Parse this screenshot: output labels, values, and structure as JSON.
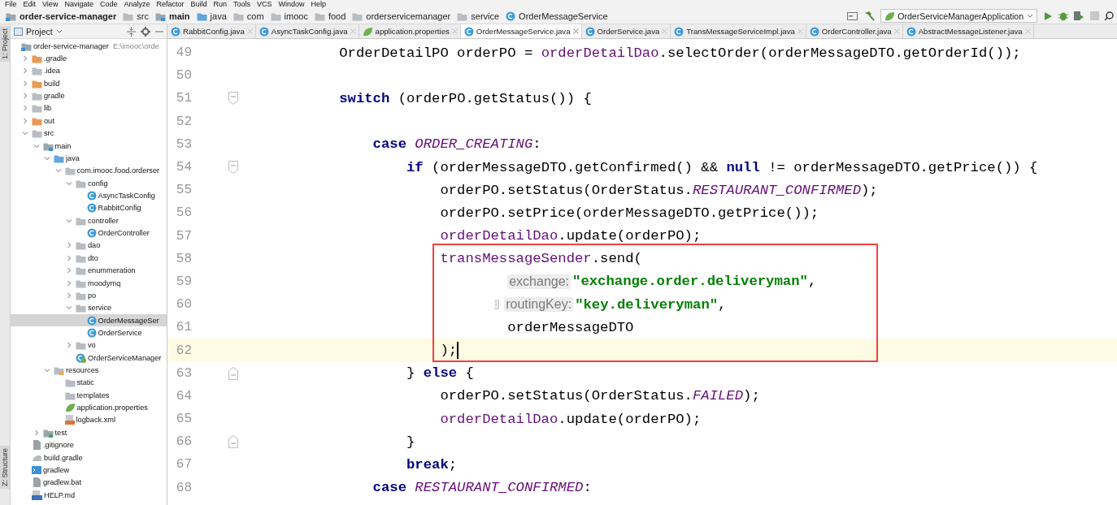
{
  "menu": [
    "File",
    "Edit",
    "View",
    "Navigate",
    "Code",
    "Analyze",
    "Refactor",
    "Build",
    "Run",
    "Tools",
    "VCS",
    "Window",
    "Help"
  ],
  "breadcrumbs": [
    {
      "label": "order-service-manager",
      "kind": "module",
      "bold": true
    },
    {
      "label": "src",
      "kind": "folder",
      "bold": false
    },
    {
      "label": "main",
      "kind": "module-folder",
      "bold": true
    },
    {
      "label": "java",
      "kind": "source-root",
      "bold": false
    },
    {
      "label": "com",
      "kind": "folder",
      "bold": false
    },
    {
      "label": "imooc",
      "kind": "folder",
      "bold": false
    },
    {
      "label": "food",
      "kind": "folder",
      "bold": false
    },
    {
      "label": "orderservicemanager",
      "kind": "folder",
      "bold": false
    },
    {
      "label": "service",
      "kind": "folder",
      "bold": false
    },
    {
      "label": "OrderMessageService",
      "kind": "class",
      "bold": false
    }
  ],
  "run_config": {
    "label": "OrderServiceManagerApplication"
  },
  "side_stripe": {
    "top": "1: Project",
    "bottom": "Z: Structure"
  },
  "project_panel": {
    "title": "Project",
    "tree": [
      {
        "label": "order-service-manager",
        "kind": "module",
        "note": "E:\\imooc\\orde",
        "selected": false,
        "children": [
          {
            "label": ".gradle",
            "kind": "excluded-folder",
            "expanded": false,
            "selected": false
          },
          {
            "label": ".idea",
            "kind": "folder",
            "expanded": false,
            "selected": false
          },
          {
            "label": "build",
            "kind": "excluded-folder",
            "expanded": false,
            "selected": false
          },
          {
            "label": "gradle",
            "kind": "folder",
            "expanded": false,
            "selected": false
          },
          {
            "label": "lib",
            "kind": "folder",
            "expanded": false,
            "selected": false
          },
          {
            "label": "out",
            "kind": "excluded-folder",
            "expanded": false,
            "selected": false
          },
          {
            "label": "src",
            "kind": "folder",
            "expanded": true,
            "selected": false,
            "children": [
              {
                "label": "main",
                "kind": "module-folder",
                "expanded": true,
                "selected": false,
                "children": [
                  {
                    "label": "java",
                    "kind": "source-root",
                    "expanded": true,
                    "selected": false,
                    "children": [
                      {
                        "label": "com.imooc.food.orderser",
                        "kind": "folder",
                        "expanded": true,
                        "selected": false,
                        "children": [
                          {
                            "label": "config",
                            "kind": "folder",
                            "expanded": true,
                            "selected": false,
                            "children": [
                              {
                                "label": "AsyncTaskConfig",
                                "kind": "class",
                                "selected": false
                              },
                              {
                                "label": "RabbitConfig",
                                "kind": "class",
                                "selected": false
                              }
                            ]
                          },
                          {
                            "label": "controller",
                            "kind": "folder",
                            "expanded": true,
                            "selected": false,
                            "children": [
                              {
                                "label": "OrderController",
                                "kind": "class",
                                "selected": false
                              }
                            ]
                          },
                          {
                            "label": "dao",
                            "kind": "folder",
                            "expanded": false,
                            "selected": false
                          },
                          {
                            "label": "dto",
                            "kind": "folder",
                            "expanded": false,
                            "selected": false
                          },
                          {
                            "label": "enummeration",
                            "kind": "folder",
                            "expanded": false,
                            "selected": false
                          },
                          {
                            "label": "moodymq",
                            "kind": "folder",
                            "expanded": false,
                            "selected": false
                          },
                          {
                            "label": "po",
                            "kind": "folder",
                            "expanded": false,
                            "selected": false
                          },
                          {
                            "label": "service",
                            "kind": "folder",
                            "expanded": true,
                            "selected": false,
                            "children": [
                              {
                                "label": "OrderMessageSer",
                                "kind": "class",
                                "selected": true
                              },
                              {
                                "label": "OrderService",
                                "kind": "class",
                                "selected": false
                              }
                            ]
                          },
                          {
                            "label": "vo",
                            "kind": "folder",
                            "expanded": false,
                            "selected": false
                          },
                          {
                            "label": "OrderServiceManager",
                            "kind": "app-class",
                            "selected": false
                          }
                        ]
                      }
                    ]
                  },
                  {
                    "label": "resources",
                    "kind": "resources-root",
                    "expanded": true,
                    "selected": false,
                    "children": [
                      {
                        "label": "static",
                        "kind": "folder",
                        "selected": false
                      },
                      {
                        "label": "templates",
                        "kind": "folder",
                        "selected": false
                      },
                      {
                        "label": "application.properties",
                        "kind": "properties",
                        "selected": false
                      },
                      {
                        "label": "logback.xml",
                        "kind": "xml",
                        "selected": false
                      }
                    ]
                  }
                ]
              },
              {
                "label": "test",
                "kind": "test-root",
                "expanded": false,
                "selected": false
              }
            ]
          },
          {
            "label": ".gitignore",
            "kind": "file",
            "selected": false
          },
          {
            "label": "build.gradle",
            "kind": "gradle-file",
            "selected": false
          },
          {
            "label": "gradlew",
            "kind": "script",
            "selected": false
          },
          {
            "label": "gradlew.bat",
            "kind": "file",
            "selected": false
          },
          {
            "label": "HELP.md",
            "kind": "markdown",
            "selected": false
          }
        ]
      }
    ]
  },
  "tabs": [
    {
      "label": "RabbitConfig.java",
      "kind": "class",
      "selected": false
    },
    {
      "label": "AsyncTaskConfig.java",
      "kind": "class",
      "selected": false
    },
    {
      "label": "application.properties",
      "kind": "properties",
      "selected": false
    },
    {
      "label": "OrderMessageService.java",
      "kind": "class",
      "selected": true
    },
    {
      "label": "OrderService.java",
      "kind": "class",
      "selected": false
    },
    {
      "label": "TransMessageServiceImpl.java",
      "kind": "class",
      "selected": false
    },
    {
      "label": "OrderController.java",
      "kind": "class",
      "selected": false
    },
    {
      "label": "AbstractMessageListener.java",
      "kind": "class",
      "selected": false
    }
  ],
  "editor": {
    "lines": [
      {
        "number": "49",
        "kind": "code",
        "current": false,
        "fold_start": false,
        "fold_end": false,
        "annotated": false,
        "tokens": [
          {
            "kind": "plain",
            "text": "OrderDetailPO orderPO = "
          },
          {
            "kind": "field",
            "text": "orderDetailDao"
          },
          {
            "kind": "plain",
            "text": ".selectOrder(orderMessageDTO.getOrderId());"
          }
        ]
      },
      {
        "number": "50",
        "kind": "code",
        "current": false,
        "fold_start": false,
        "fold_end": false,
        "annotated": false
      },
      {
        "number": "51",
        "kind": "code",
        "current": false,
        "fold_start": true,
        "fold_end": false,
        "annotated": false,
        "tokens": [
          {
            "kind": "keyword",
            "text": "switch"
          },
          {
            "kind": "plain",
            "text": " (orderPO.getStatus()) {"
          }
        ],
        "children": [
          {
            "number": "52",
            "kind": "code",
            "current": false,
            "fold_start": false,
            "fold_end": false,
            "annotated": false
          },
          {
            "number": "53",
            "kind": "code",
            "current": false,
            "fold_start": false,
            "fold_end": false,
            "annotated": false,
            "tokens": [
              {
                "kind": "keyword",
                "text": "case"
              },
              {
                "kind": "constant",
                "text": "ORDER_CREATING"
              },
              {
                "kind": "plain",
                "text": ":"
              }
            ],
            "children": [
              {
                "number": "54",
                "kind": "code",
                "current": false,
                "fold_start": true,
                "fold_end": false,
                "annotated": false,
                "tokens": [
                  {
                    "kind": "keyword",
                    "text": "if"
                  },
                  {
                    "kind": "plain",
                    "text": " (orderMessageDTO.getConfirmed() && "
                  },
                  {
                    "kind": "keyword",
                    "text": "null"
                  },
                  {
                    "kind": "plain",
                    "text": " != orderMessageDTO.getPrice()) {"
                  }
                ],
                "children": [
                  {
                    "number": "55",
                    "kind": "code",
                    "current": false,
                    "fold_start": false,
                    "fold_end": false,
                    "annotated": false,
                    "tokens": [
                      {
                        "kind": "plain",
                        "text": "orderPO.setStatus(OrderStatus."
                      },
                      {
                        "kind": "constant",
                        "text": "RESTAURANT_CONFIRMED"
                      },
                      {
                        "kind": "plain",
                        "text": ");"
                      }
                    ]
                  },
                  {
                    "number": "56",
                    "kind": "code",
                    "current": false,
                    "fold_start": false,
                    "fold_end": false,
                    "annotated": false,
                    "tokens": [
                      {
                        "kind": "plain",
                        "text": "orderPO.setPrice(orderMessageDTO.getPrice());"
                      }
                    ]
                  },
                  {
                    "number": "57",
                    "kind": "code",
                    "current": false,
                    "fold_start": false,
                    "fold_end": false,
                    "annotated": false,
                    "tokens": [
                      {
                        "kind": "field",
                        "text": "orderDetailDao"
                      },
                      {
                        "kind": "plain",
                        "text": ".update(orderPO);"
                      }
                    ]
                  },
                  {
                    "number": "58",
                    "kind": "code",
                    "current": false,
                    "fold_start": false,
                    "fold_end": false,
                    "annotated": true,
                    "tokens": [
                      {
                        "kind": "field",
                        "text": "transMessageSender"
                      },
                      {
                        "kind": "plain",
                        "text": ".send("
                      }
                    ],
                    "children": [
                      {
                        "number": "59",
                        "kind": "continuation",
                        "current": false,
                        "fold_start": false,
                        "fold_end": false,
                        "annotated": true,
                        "tokens": [
                          {
                            "kind": "hint",
                            "text": "exchange:"
                          },
                          {
                            "kind": "string",
                            "text": "\"exchange.order.deliveryman\""
                          },
                          {
                            "kind": "plain",
                            "text": ","
                          }
                        ]
                      },
                      {
                        "number": "60",
                        "kind": "continuation",
                        "current": false,
                        "fold_start": false,
                        "fold_end": false,
                        "annotated": true,
                        "tokens": [
                          {
                            "kind": "marker"
                          },
                          {
                            "kind": "hint",
                            "text": "routingKey:"
                          },
                          {
                            "kind": "string",
                            "text": "\"key.deliveryman\""
                          },
                          {
                            "kind": "plain",
                            "text": ","
                          }
                        ]
                      },
                      {
                        "number": "61",
                        "kind": "continuation",
                        "current": false,
                        "fold_start": false,
                        "fold_end": false,
                        "annotated": true,
                        "tokens": [
                          {
                            "kind": "plain",
                            "text": "orderMessageDTO"
                          }
                        ]
                      }
                    ]
                  },
                  {
                    "number": "62",
                    "kind": "code",
                    "current": true,
                    "fold_start": false,
                    "fold_end": false,
                    "annotated": true,
                    "tokens": [
                      {
                        "kind": "plain",
                        "text": ");"
                      }
                    ]
                  }
                ]
              },
              {
                "number": "63",
                "kind": "code",
                "current": false,
                "fold_start": false,
                "fold_end": true,
                "annotated": false,
                "tokens": [
                  {
                    "kind": "plain",
                    "text": "} "
                  },
                  {
                    "kind": "keyword",
                    "text": "else"
                  },
                  {
                    "kind": "plain",
                    "text": " {"
                  }
                ],
                "children": [
                  {
                    "number": "64",
                    "kind": "code",
                    "current": false,
                    "fold_start": false,
                    "fold_end": false,
                    "annotated": false,
                    "tokens": [
                      {
                        "kind": "plain",
                        "text": "orderPO.setStatus(OrderStatus."
                      },
                      {
                        "kind": "constant",
                        "text": "FAILED"
                      },
                      {
                        "kind": "plain",
                        "text": ");"
                      }
                    ]
                  },
                  {
                    "number": "65",
                    "kind": "code",
                    "current": false,
                    "fold_start": false,
                    "fold_end": false,
                    "annotated": false,
                    "tokens": [
                      {
                        "kind": "field",
                        "text": "orderDetailDao"
                      },
                      {
                        "kind": "plain",
                        "text": ".update(orderPO);"
                      }
                    ]
                  }
                ]
              },
              {
                "number": "66",
                "kind": "code",
                "current": false,
                "fold_start": false,
                "fold_end": true,
                "annotated": false,
                "tokens": [
                  {
                    "kind": "plain",
                    "text": "}"
                  }
                ]
              },
              {
                "number": "67",
                "kind": "code",
                "current": false,
                "fold_start": false,
                "fold_end": false,
                "annotated": false,
                "tokens": [
                  {
                    "kind": "keyword",
                    "text": "break"
                  },
                  {
                    "kind": "plain",
                    "text": ";"
                  }
                ]
              }
            ]
          },
          {
            "number": "68",
            "kind": "code",
            "current": false,
            "fold_start": false,
            "fold_end": false,
            "annotated": false,
            "tokens": [
              {
                "kind": "keyword",
                "text": "case"
              },
              {
                "kind": "constant",
                "text": "RESTAURANT_CONFIRMED"
              },
              {
                "kind": "plain",
                "text": ":"
              }
            ]
          }
        ]
      }
    ]
  }
}
